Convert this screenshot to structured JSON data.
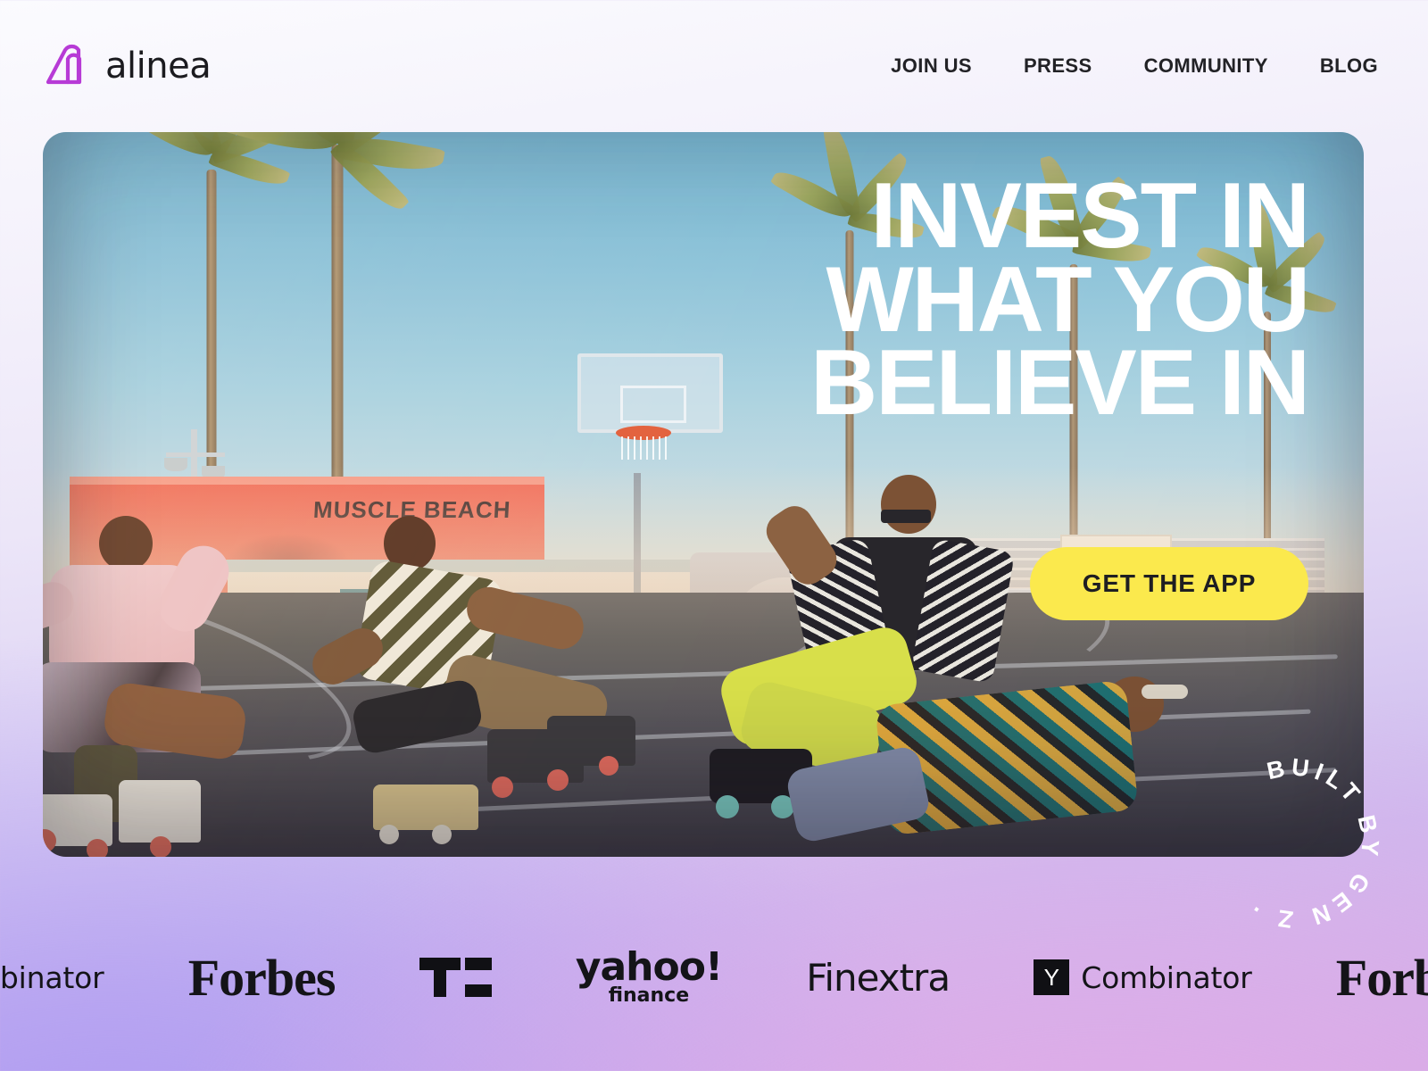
{
  "brand": {
    "name": "alinea",
    "mark_icon": "alinea-arch-logo-icon",
    "mark_color": "#b73bd6"
  },
  "nav": {
    "items": [
      {
        "label": "JOIN US"
      },
      {
        "label": "PRESS"
      },
      {
        "label": "COMMUNITY"
      },
      {
        "label": "BLOG"
      }
    ]
  },
  "hero": {
    "headline_lines": [
      "INVEST IN",
      "WHAT YOU",
      "BELIEVE IN"
    ],
    "cta_label": "GET THE APP",
    "cta_color": "#fbe94d",
    "cta_text_color": "#1e1e22",
    "badge_text": "BUILT BY GEN Z ·",
    "image_alt": "Four young roller skaters posing on a Venice Beach basketball court at sunset with palm trees and the Muscle Beach building behind them",
    "photo_sign_text": "MUSCLE BEACH"
  },
  "press_logos": {
    "items": [
      {
        "name": "y-combinator-partial",
        "text": "ombinator"
      },
      {
        "name": "forbes",
        "text": "Forbes"
      },
      {
        "name": "techcrunch",
        "text": "TC"
      },
      {
        "name": "yahoo-finance",
        "line1": "yahoo!",
        "line2": "finance"
      },
      {
        "name": "finextra",
        "text": "Finextra"
      },
      {
        "name": "y-combinator",
        "mark": "Y",
        "text": "Combinator"
      },
      {
        "name": "forbes-partial",
        "text": "Forbe"
      }
    ]
  },
  "theme": {
    "background_top": "#f7f5fd",
    "background_bottom_left": "#aa98f3",
    "background_bottom_right": "#e0bee8",
    "text_dark": "#1b1b1f",
    "text_light": "#ffffff"
  }
}
